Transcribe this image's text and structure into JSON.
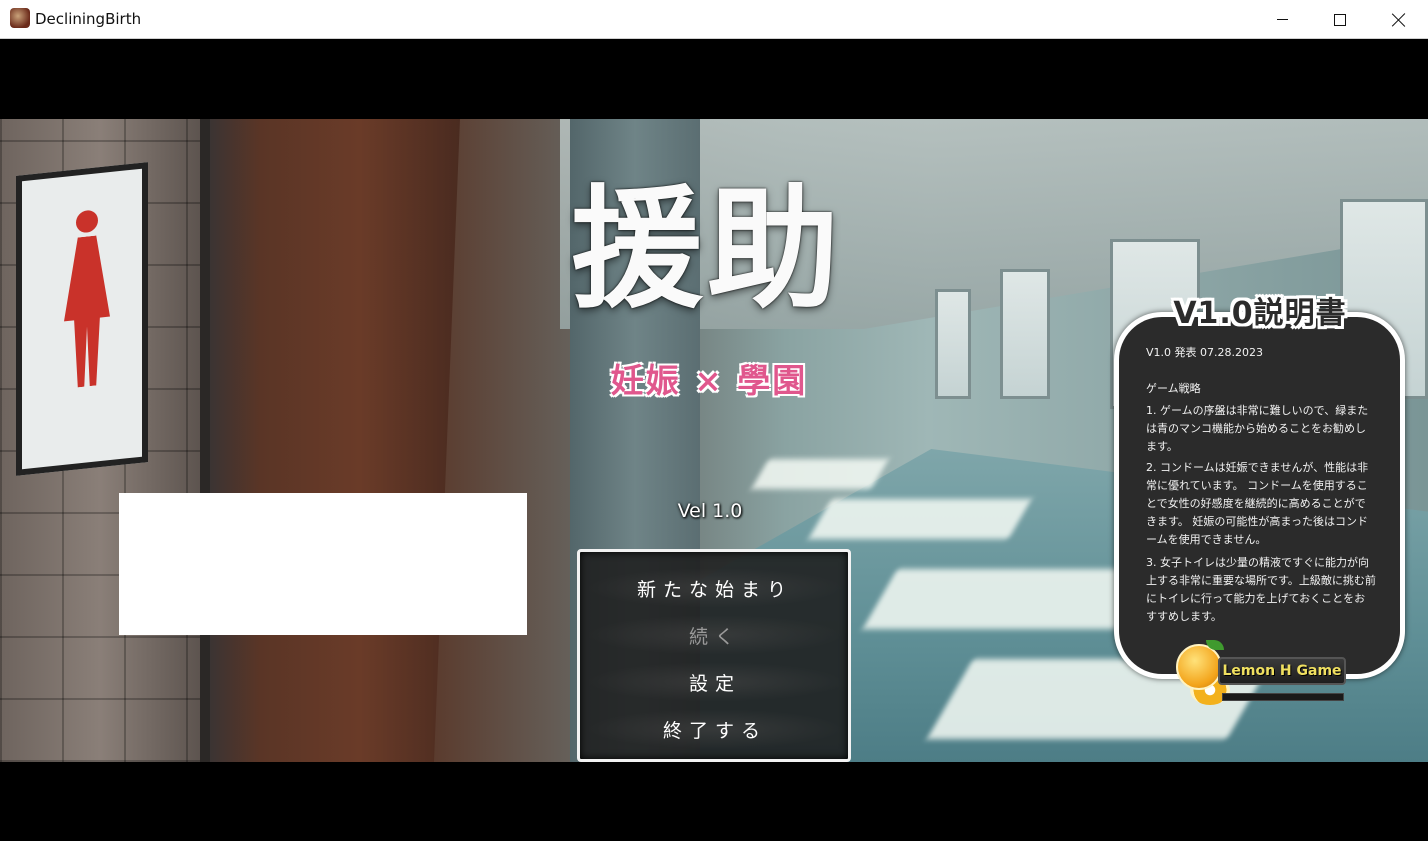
{
  "window": {
    "title": "DecliningBirth",
    "icon": "app-icon"
  },
  "logo": {
    "main": "援助",
    "sub": "妊娠 × 學園"
  },
  "version": "Vel 1.0",
  "menu": {
    "items": [
      {
        "label": "新たな始まり",
        "enabled": true
      },
      {
        "label": "続く",
        "enabled": false
      },
      {
        "label": "設定",
        "enabled": true
      },
      {
        "label": "終了する",
        "enabled": true
      }
    ]
  },
  "info_panel": {
    "title": "V1.0説明書",
    "date": "V1.0 発表 07.28.2023",
    "heading": "ゲーム戦略",
    "paragraphs": [
      "1. ゲームの序盤は非常に難しいので、緑または青のマンコ機能から始めることをお勧めします。",
      "2. コンドームは妊娠できませんが、性能は非常に優れています。 コンドームを使用することで女性の好感度を継続的に高めることができます。 妊娠の可能性が高まった後はコンドームを使用できません。",
      "3. 女子トイレは少量の精液ですぐに能力が向上する非常に重要な場所です。上級敵に挑む前にトイレに行って能力を上げておくことをおすすめします。"
    ]
  },
  "brand": {
    "label": "Lemon H Game"
  },
  "colors": {
    "accent_pink": "#e0578d",
    "panel_bg": "#2b2b2b",
    "brand_yellow": "#f0e060"
  }
}
